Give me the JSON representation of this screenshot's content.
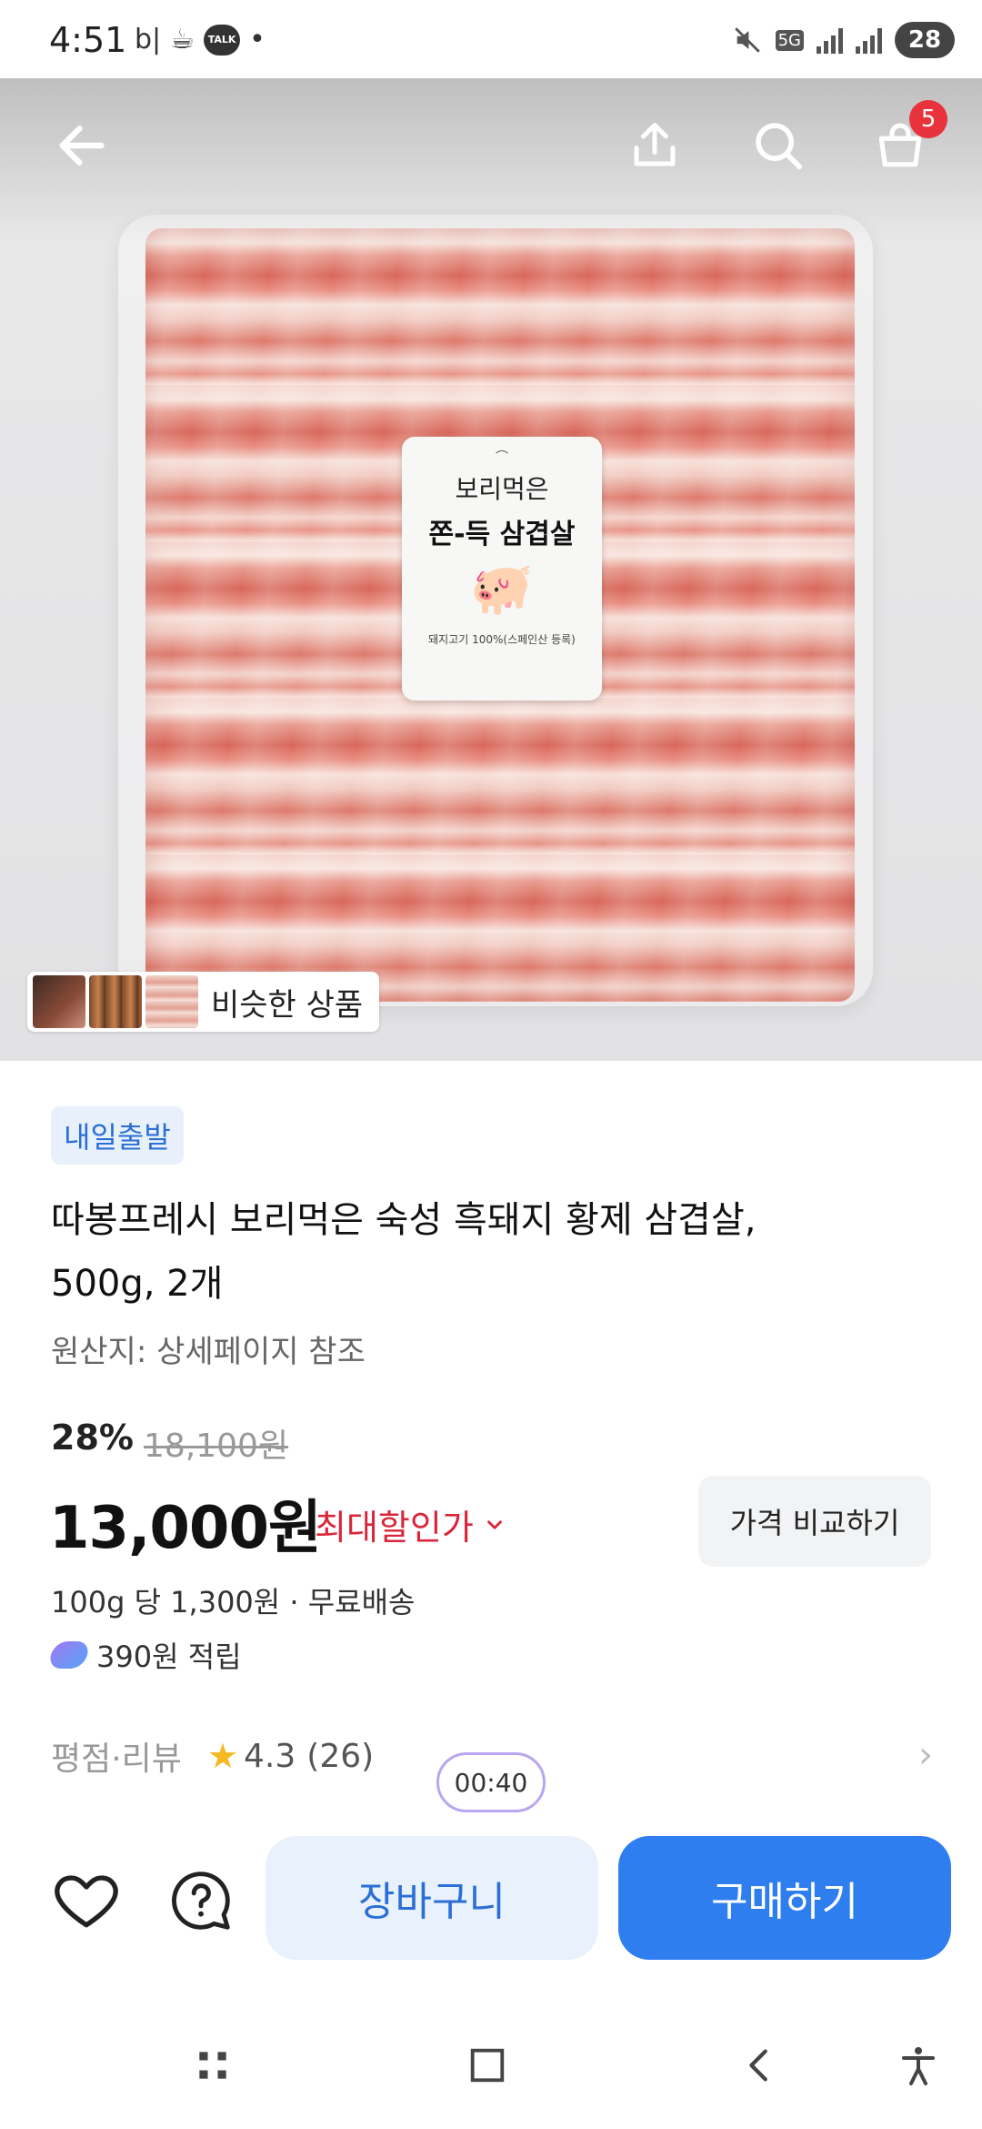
{
  "status_bar": {
    "time": "4:51",
    "left_glyph": "b|",
    "talk_label": "TALK",
    "dot": "•",
    "network": "5G",
    "battery": "28"
  },
  "hero": {
    "label_line1": "보리먹은",
    "label_line2": "쫀-득 삼겹살",
    "label_small": "돼지고기 100%(스페인산 등록)",
    "cart_count": "5",
    "similar_label": "비슷한 상품"
  },
  "product": {
    "delivery_badge": "내일출발",
    "title": "따봉프레시 보리먹은 숙성 흑돼지 황제 삼겹살, 500g, 2개",
    "origin": "원산지: 상세페이지 참조",
    "discount": "28%",
    "original_price": "18,100원",
    "price": "13,000원",
    "best_price_label": "최대할인가",
    "compare_label": "가격 비교하기",
    "unit_price": "100g 당 1,300원 · 무료배송",
    "points": "390원 적립"
  },
  "rating": {
    "label": "평점·리뷰",
    "score": "4.3",
    "count": "(26)",
    "timer": "00:40"
  },
  "actions": {
    "cart_add": "장바구니",
    "buy": "구매하기"
  },
  "colors": {
    "accent_blue": "#2f7ef0",
    "discount_red": "#d9263a",
    "badge_red": "#e8323c",
    "star": "#f5b820"
  }
}
